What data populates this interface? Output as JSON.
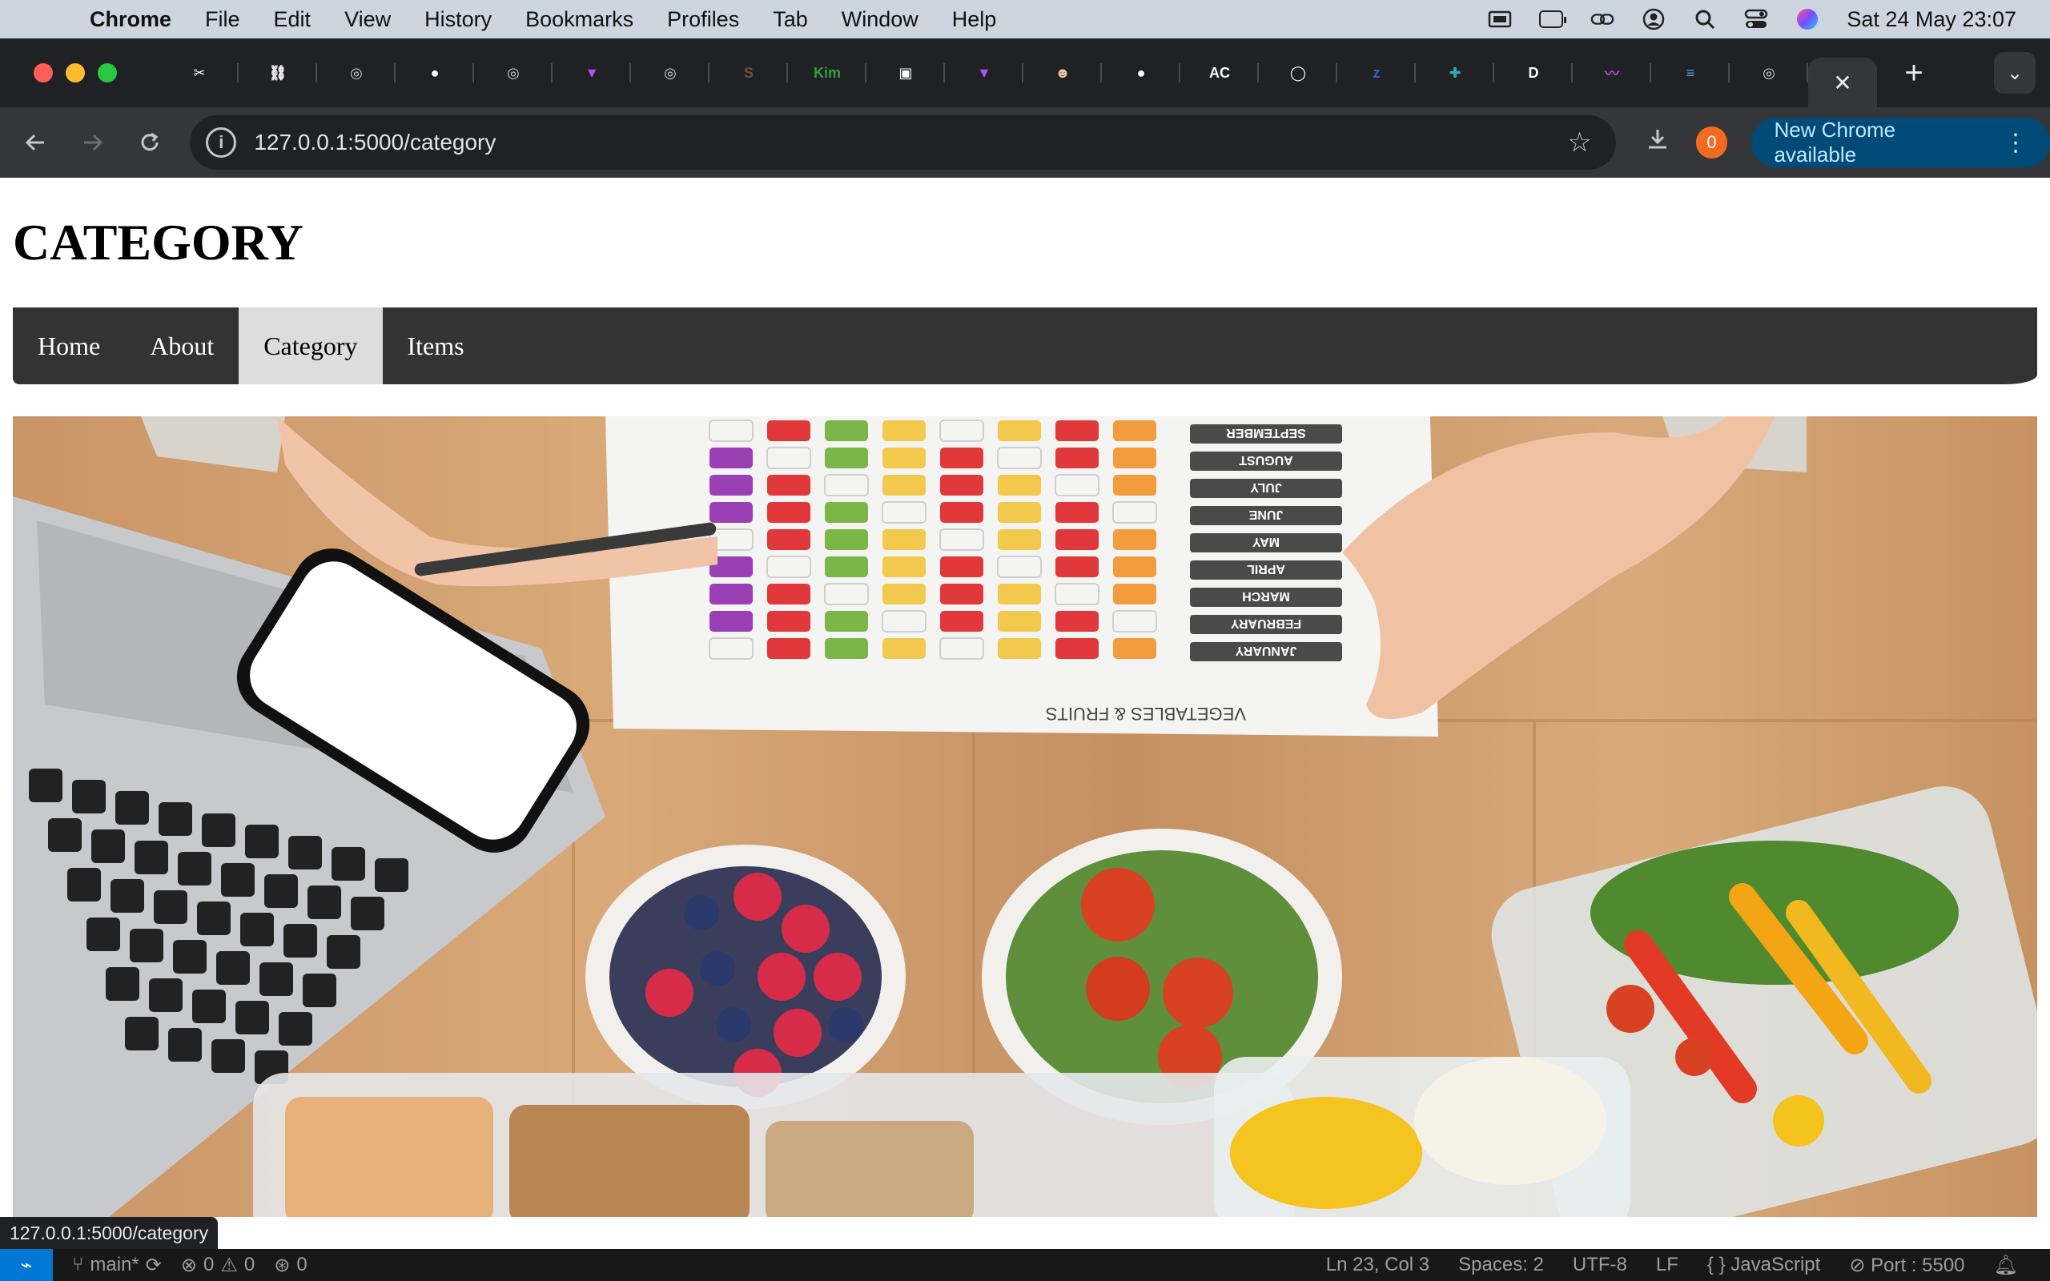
{
  "menubar": {
    "app_name": "Chrome",
    "menus": [
      "File",
      "Edit",
      "View",
      "History",
      "Bookmarks",
      "Profiles",
      "Tab",
      "Window",
      "Help"
    ],
    "datetime": "Sat 24 May  23:07"
  },
  "tabs": [
    {
      "icon": "broken-link-icon",
      "glyph": "✂",
      "color": "#ffffff"
    },
    {
      "icon": "link-icon",
      "glyph": "⛓",
      "color": "#ffffff"
    },
    {
      "icon": "chrome-icon",
      "glyph": "◎",
      "color": "#cfd2d6"
    },
    {
      "icon": "github-icon",
      "glyph": "●",
      "color": "#ffffff"
    },
    {
      "icon": "chrome-icon",
      "glyph": "◎",
      "color": "#cfd2d6"
    },
    {
      "icon": "vite-icon",
      "glyph": "▼",
      "color": "#a855f7"
    },
    {
      "icon": "chrome-icon",
      "glyph": "◎",
      "color": "#cfd2d6"
    },
    {
      "icon": "s-avatar-icon",
      "glyph": "S",
      "color": "#6b4f3a"
    },
    {
      "icon": "kim-icon",
      "glyph": "Kim",
      "color": "#2ea043"
    },
    {
      "icon": "qr-icon",
      "glyph": "▣",
      "color": "#ffffff"
    },
    {
      "icon": "vite-icon",
      "glyph": "▼",
      "color": "#a855f7"
    },
    {
      "icon": "mascot-icon",
      "glyph": "☻",
      "color": "#e8c9a0"
    },
    {
      "icon": "circle-icon",
      "glyph": "●",
      "color": "#ffffff"
    },
    {
      "icon": "ac-icon",
      "glyph": "AC",
      "color": "#ffffff"
    },
    {
      "icon": "chat-icon",
      "glyph": "◯",
      "color": "#ffffff"
    },
    {
      "icon": "zzz-icon",
      "glyph": "z",
      "color": "#3b5bdb"
    },
    {
      "icon": "puzzle-icon",
      "glyph": "✚",
      "color": "#2bb3a3"
    },
    {
      "icon": "d-icon",
      "glyph": "D",
      "color": "#ffffff"
    },
    {
      "icon": "waveform-icon",
      "glyph": "〰",
      "color": "#9b59b6"
    },
    {
      "icon": "doc-icon",
      "glyph": "≡",
      "color": "#4aa3df"
    },
    {
      "icon": "chrome-icon",
      "glyph": "◎",
      "color": "#cfd2d6"
    }
  ],
  "browser": {
    "url": "127.0.0.1:5000/category",
    "extension_badge": "0",
    "update_label": "New Chrome available"
  },
  "page": {
    "title": "CATEGORY",
    "nav": [
      {
        "label": "Home",
        "active": false
      },
      {
        "label": "About",
        "active": false
      },
      {
        "label": "Category",
        "active": true
      },
      {
        "label": "Items",
        "active": false
      }
    ],
    "hover_url": "127.0.0.1:5000/category"
  },
  "chart_labels": {
    "months": [
      "SEPTEMBER",
      "AUGUST",
      "JULY",
      "JUNE",
      "MAY",
      "APRIL",
      "MARCH",
      "FEBRUARY",
      "JANUARY"
    ],
    "chart_title": "VEGETABLES & FRUITS"
  },
  "vscode": {
    "branch": "main*",
    "errors": "0",
    "warnings": "0",
    "ports": "0",
    "position": "Ln 23, Col 3",
    "spaces": "Spaces: 2",
    "encoding": "UTF-8",
    "eol": "LF",
    "language": "JavaScript",
    "live_server": "Port : 5500"
  }
}
